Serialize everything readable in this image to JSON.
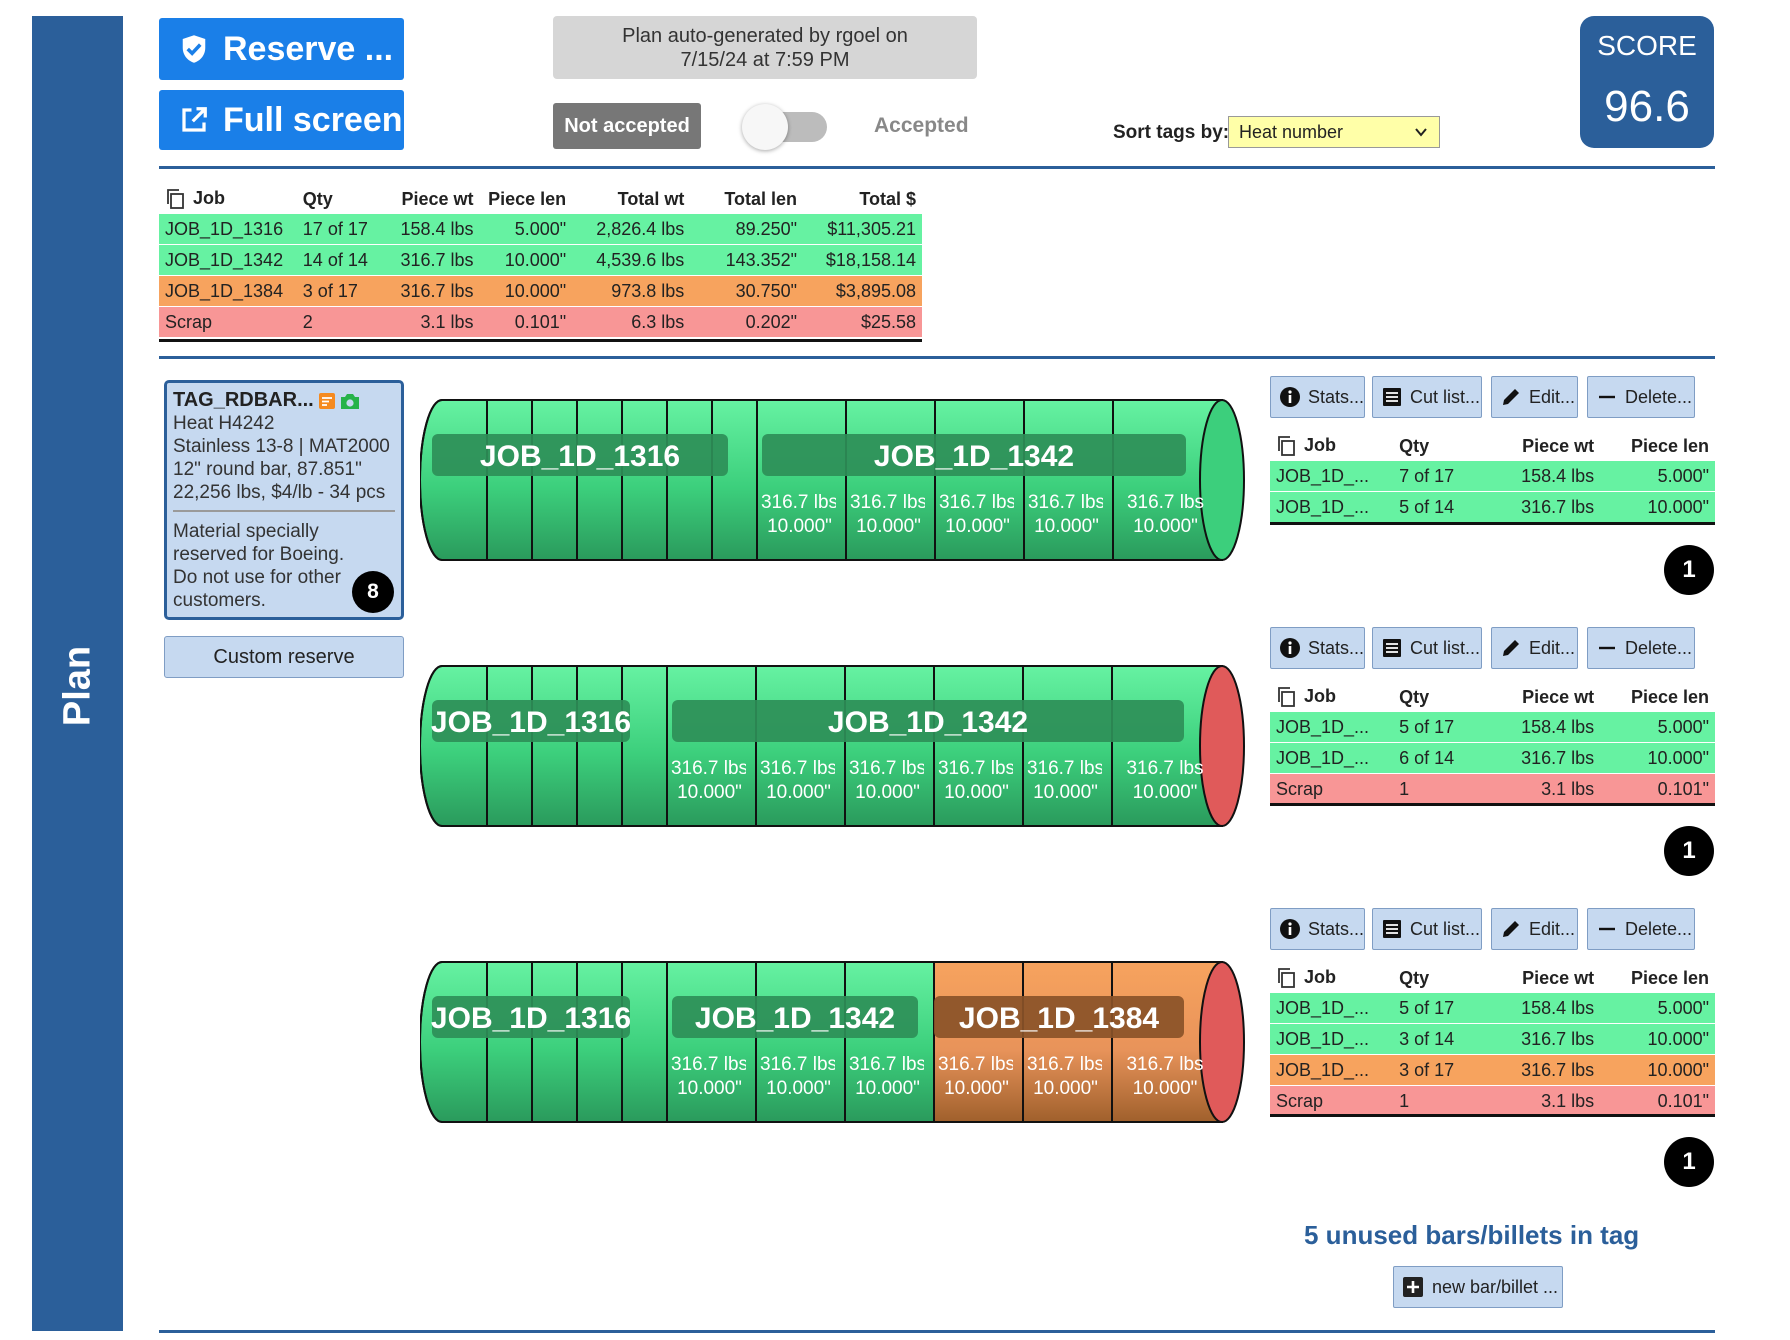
{
  "sidebar": {
    "label": "Plan"
  },
  "header": {
    "reserve_label": "Reserve ...",
    "fullscreen_label": "Full screen",
    "plan_info_line1": "Plan auto-generated by rgoel on",
    "plan_info_line2": "7/15/24 at 7:59 PM",
    "not_accepted_label": "Not accepted",
    "accepted_label": "Accepted",
    "sort_label": "Sort tags by:",
    "sort_value": "Heat number",
    "score_title": "SCORE",
    "score_value": "96.6"
  },
  "summary": {
    "headers": [
      "Job",
      "Qty",
      "Piece wt",
      "Piece len",
      "Total wt",
      "Total len",
      "Total $"
    ],
    "rows": [
      {
        "color": "green",
        "cells": [
          "JOB_1D_1316",
          "17 of 17",
          "158.4 lbs",
          "5.000\"",
          "2,826.4 lbs",
          "89.250\"",
          "$11,305.21"
        ]
      },
      {
        "color": "green",
        "cells": [
          "JOB_1D_1342",
          "14 of 14",
          "316.7 lbs",
          "10.000\"",
          "4,539.6 lbs",
          "143.352\"",
          "$18,158.14"
        ]
      },
      {
        "color": "orange",
        "cells": [
          "JOB_1D_1384",
          "3 of 17",
          "316.7 lbs",
          "10.000\"",
          "973.8 lbs",
          "30.750\"",
          "$3,895.08"
        ]
      },
      {
        "color": "red",
        "cells": [
          "Scrap",
          "2",
          "3.1 lbs",
          "0.101\"",
          "6.3 lbs",
          "0.202\"",
          "$25.58"
        ]
      }
    ]
  },
  "tag": {
    "title": "TAG_RDBAR...",
    "heat": "Heat H4242",
    "material": "Stainless 13-8 | MAT2000",
    "shape": "12\" round bar, 87.851\"",
    "weight": "22,256 lbs, $4/lb - 34 pcs",
    "note": "Material specially reserved for Boeing. Do not use for other customers.",
    "badge": "8",
    "custom_reserve_label": "Custom reserve"
  },
  "buttons": {
    "stats": "Stats...",
    "cutlist": "Cut list...",
    "edit": "Edit...",
    "delete": "Delete..."
  },
  "bar_table_headers": [
    "Job",
    "Qty",
    "Piece wt",
    "Piece len"
  ],
  "bars": [
    {
      "badge": "1",
      "segments": [
        {
          "label": "JOB_1D_1316",
          "color": "green"
        },
        {
          "label": "JOB_1D_1342",
          "color": "green"
        }
      ],
      "piece_label_wt": "316.7 lbs",
      "piece_label_len": "10.000\"",
      "rows": [
        {
          "color": "green",
          "cells": [
            "JOB_1D_...",
            "7 of 17",
            "158.4 lbs",
            "5.000\""
          ]
        },
        {
          "color": "green",
          "cells": [
            "JOB_1D_...",
            "5 of 14",
            "316.7 lbs",
            "10.000\""
          ]
        }
      ]
    },
    {
      "badge": "1",
      "segments": [
        {
          "label": "JOB_1D_1316",
          "color": "green"
        },
        {
          "label": "JOB_1D_1342",
          "color": "green"
        }
      ],
      "piece_label_wt": "316.7 lbs",
      "piece_label_len": "10.000\"",
      "rows": [
        {
          "color": "green",
          "cells": [
            "JOB_1D_...",
            "5 of 17",
            "158.4 lbs",
            "5.000\""
          ]
        },
        {
          "color": "green",
          "cells": [
            "JOB_1D_...",
            "6 of 14",
            "316.7 lbs",
            "10.000\""
          ]
        },
        {
          "color": "red",
          "cells": [
            "Scrap",
            "1",
            "3.1 lbs",
            "0.101\""
          ]
        }
      ]
    },
    {
      "badge": "1",
      "segments": [
        {
          "label": "JOB_1D_1316",
          "color": "green"
        },
        {
          "label": "JOB_1D_1342",
          "color": "green"
        },
        {
          "label": "JOB_1D_1384",
          "color": "orange"
        }
      ],
      "piece_label_wt": "316.7 lbs",
      "piece_label_len": "10.000\"",
      "rows": [
        {
          "color": "green",
          "cells": [
            "JOB_1D_...",
            "5 of 17",
            "158.4 lbs",
            "5.000\""
          ]
        },
        {
          "color": "green",
          "cells": [
            "JOB_1D_...",
            "3 of 14",
            "316.7 lbs",
            "10.000\""
          ]
        },
        {
          "color": "orange",
          "cells": [
            "JOB_1D_...",
            "3 of 17",
            "316.7 lbs",
            "10.000\""
          ]
        },
        {
          "color": "red",
          "cells": [
            "Scrap",
            "1",
            "3.1 lbs",
            "0.101\""
          ]
        }
      ]
    }
  ],
  "footer": {
    "unused_text": "5 unused bars/billets in tag",
    "new_bar_label": "new bar/billet ..."
  },
  "colors": {
    "accent": "#2b5f9a",
    "button_blue": "#1a7fe8",
    "green": "#66f2a2",
    "orange": "#f7a35e",
    "red": "#f89696"
  }
}
